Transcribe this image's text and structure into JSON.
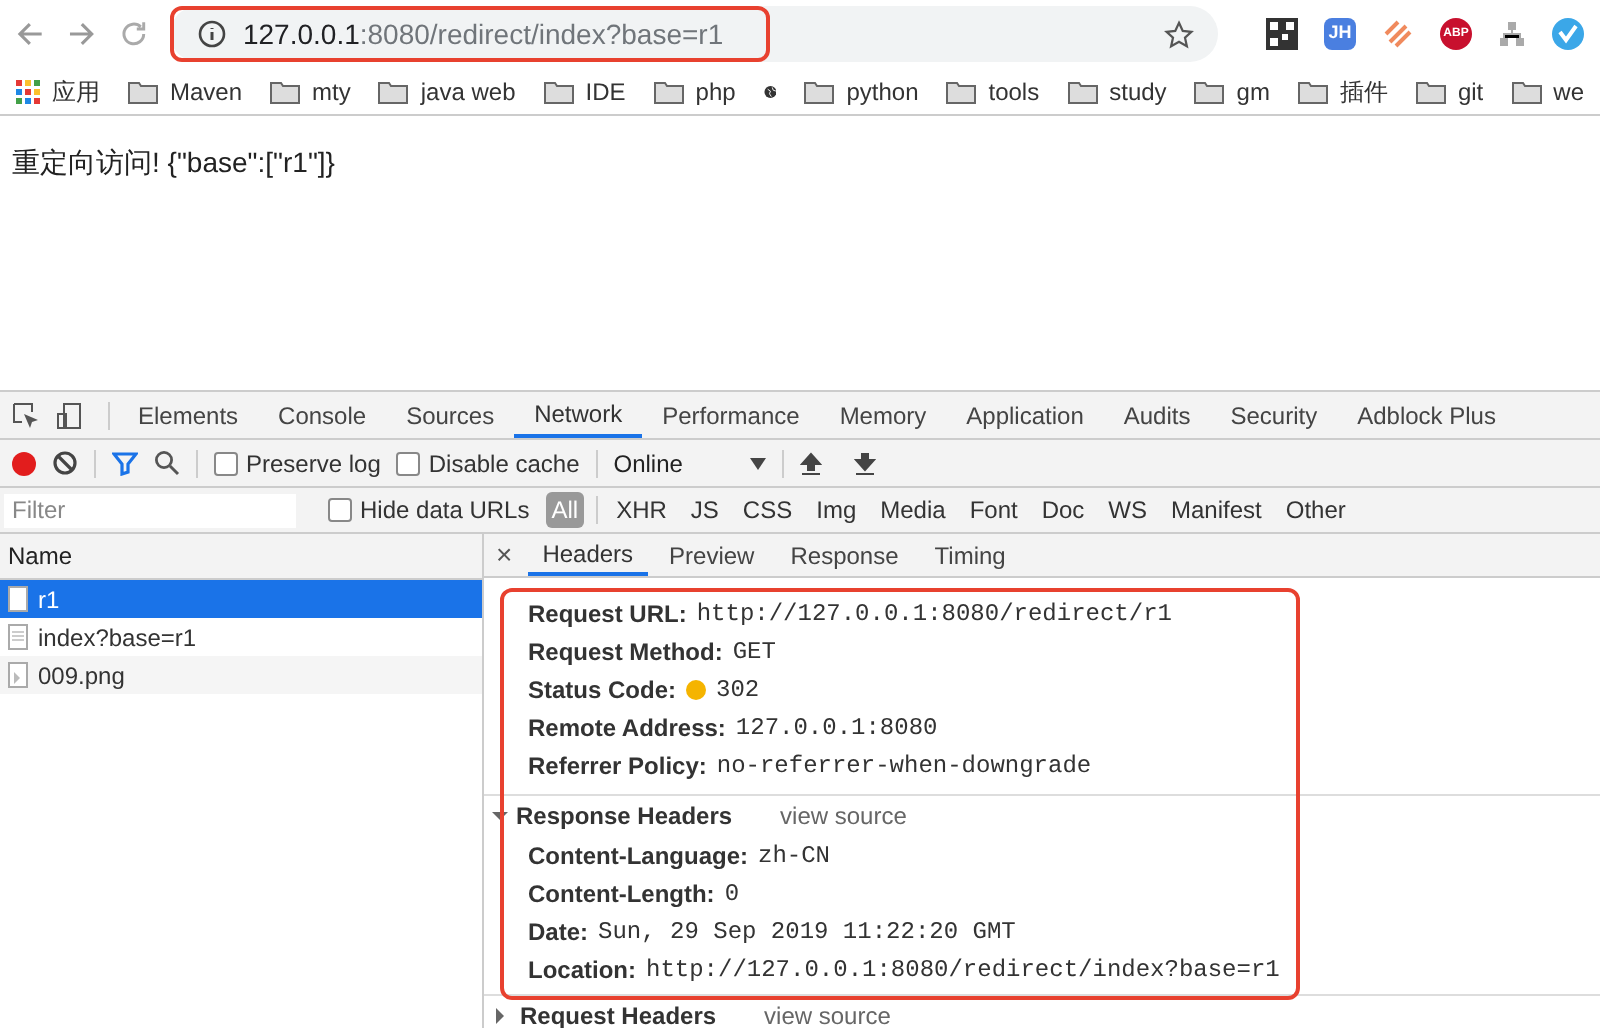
{
  "address_bar": {
    "host": "127.0.0.1",
    "path": ":8080/redirect/index?base=r1"
  },
  "extensions": [
    {
      "kind": "qr"
    },
    {
      "kind": "text",
      "label": "JH"
    },
    {
      "kind": "stripes"
    },
    {
      "kind": "stop",
      "label": "ABP"
    },
    {
      "kind": "tree"
    },
    {
      "kind": "check"
    }
  ],
  "bookmarks": [
    {
      "kind": "apps",
      "label": "应用"
    },
    {
      "kind": "folder",
      "label": "Maven"
    },
    {
      "kind": "folder",
      "label": "mty"
    },
    {
      "kind": "folder",
      "label": "java web"
    },
    {
      "kind": "folder",
      "label": "IDE"
    },
    {
      "kind": "folder",
      "label": "php"
    },
    {
      "kind": "site"
    },
    {
      "kind": "folder",
      "label": "python"
    },
    {
      "kind": "folder",
      "label": "tools"
    },
    {
      "kind": "folder",
      "label": "study"
    },
    {
      "kind": "folder",
      "label": "gm"
    },
    {
      "kind": "folder",
      "label": "插件"
    },
    {
      "kind": "folder",
      "label": "git"
    },
    {
      "kind": "folder",
      "label": "we"
    }
  ],
  "page": {
    "text": "重定向访问! {\"base\":[\"r1\"]}"
  },
  "devtools": {
    "tabs": [
      {
        "label": "Elements",
        "selected": false
      },
      {
        "label": "Console",
        "selected": false
      },
      {
        "label": "Sources",
        "selected": false
      },
      {
        "label": "Network",
        "selected": true
      },
      {
        "label": "Performance",
        "selected": false
      },
      {
        "label": "Memory",
        "selected": false
      },
      {
        "label": "Application",
        "selected": false
      },
      {
        "label": "Audits",
        "selected": false
      },
      {
        "label": "Security",
        "selected": false
      },
      {
        "label": "Adblock Plus",
        "selected": false
      }
    ],
    "toolbar": {
      "recording": true,
      "preserve_log": {
        "label": "Preserve log",
        "checked": false
      },
      "disable_cache": {
        "label": "Disable cache",
        "checked": false
      },
      "throttling": "Online"
    },
    "filter": {
      "placeholder": "Filter",
      "hide_data_urls": {
        "label": "Hide data URLs",
        "checked": false
      },
      "types": [
        {
          "label": "All",
          "selected": true
        },
        {
          "label": "XHR",
          "selected": false
        },
        {
          "label": "JS",
          "selected": false
        },
        {
          "label": "CSS",
          "selected": false
        },
        {
          "label": "Img",
          "selected": false
        },
        {
          "label": "Media",
          "selected": false
        },
        {
          "label": "Font",
          "selected": false
        },
        {
          "label": "Doc",
          "selected": false
        },
        {
          "label": "WS",
          "selected": false
        },
        {
          "label": "Manifest",
          "selected": false
        },
        {
          "label": "Other",
          "selected": false
        }
      ]
    },
    "requests": {
      "column": "Name",
      "rows": [
        {
          "name": "r1",
          "kind": "document",
          "selected": true
        },
        {
          "name": "index?base=r1",
          "kind": "document",
          "selected": false
        },
        {
          "name": "009.png",
          "kind": "image",
          "selected": false
        }
      ]
    },
    "detail": {
      "close": "×",
      "tabs": [
        {
          "label": "Headers",
          "selected": true
        },
        {
          "label": "Preview",
          "selected": false
        },
        {
          "label": "Response",
          "selected": false
        },
        {
          "label": "Timing",
          "selected": false
        }
      ],
      "general": [
        {
          "key": "Request URL:",
          "value": "http://127.0.0.1:8080/redirect/r1"
        },
        {
          "key": "Request Method:",
          "value": "GET"
        },
        {
          "key": "Status Code:",
          "value": "302",
          "color": "#f5b400"
        },
        {
          "key": "Remote Address:",
          "value": "127.0.0.1:8080"
        },
        {
          "key": "Referrer Policy:",
          "value": "no-referrer-when-downgrade"
        }
      ],
      "sections": [
        {
          "title": "Response Headers",
          "expanded": true,
          "view_source": "view source",
          "rows": [
            {
              "key": "Content-Language:",
              "value": "zh-CN"
            },
            {
              "key": "Content-Length:",
              "value": "0"
            },
            {
              "key": "Date:",
              "value": "Sun, 29 Sep 2019 11:22:20 GMT"
            },
            {
              "key": "Location:",
              "value": "http://127.0.0.1:8080/redirect/index?base=r1"
            }
          ]
        },
        {
          "title": "Request Headers",
          "expanded": false,
          "view_source": "view source"
        }
      ]
    }
  }
}
